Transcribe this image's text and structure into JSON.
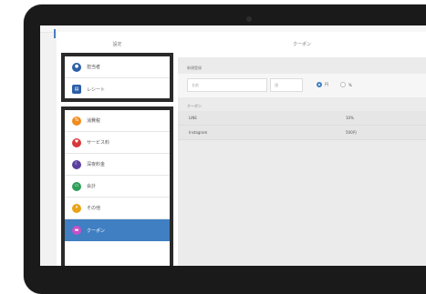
{
  "left": {
    "title": "設定",
    "group1": [
      {
        "label": "担当者",
        "icon": "person-icon",
        "color": "#2d5fa8"
      },
      {
        "label": "レシート",
        "icon": "receipt-icon",
        "color": "#2d5fa8"
      }
    ],
    "group2": [
      {
        "label": "消費税",
        "icon": "percent-icon",
        "color": "#f08c1e"
      },
      {
        "label": "サービス料",
        "icon": "heart-icon",
        "color": "#d9373b"
      },
      {
        "label": "深夜料金",
        "icon": "moon-icon",
        "color": "#5a3f9e"
      },
      {
        "label": "会計",
        "icon": "card-icon",
        "color": "#2e9f58"
      },
      {
        "label": "その他",
        "icon": "tag-icon",
        "color": "#e8a317"
      },
      {
        "label": "クーポン",
        "icon": "coupon-icon",
        "color": "#c850c8",
        "active": true
      }
    ]
  },
  "main": {
    "title": "クーポン",
    "new_label": "新規登録",
    "name_placeholder": "名前",
    "value_placeholder": "値",
    "unit_yen": "円",
    "unit_percent": "%",
    "list_label": "クーポン",
    "rows": [
      {
        "name": "LINE",
        "value": "10%"
      },
      {
        "name": "Instagram",
        "value": "500円"
      }
    ]
  },
  "colors": {
    "accent": "#3f7fc2",
    "frame": "#1a1a1a"
  }
}
